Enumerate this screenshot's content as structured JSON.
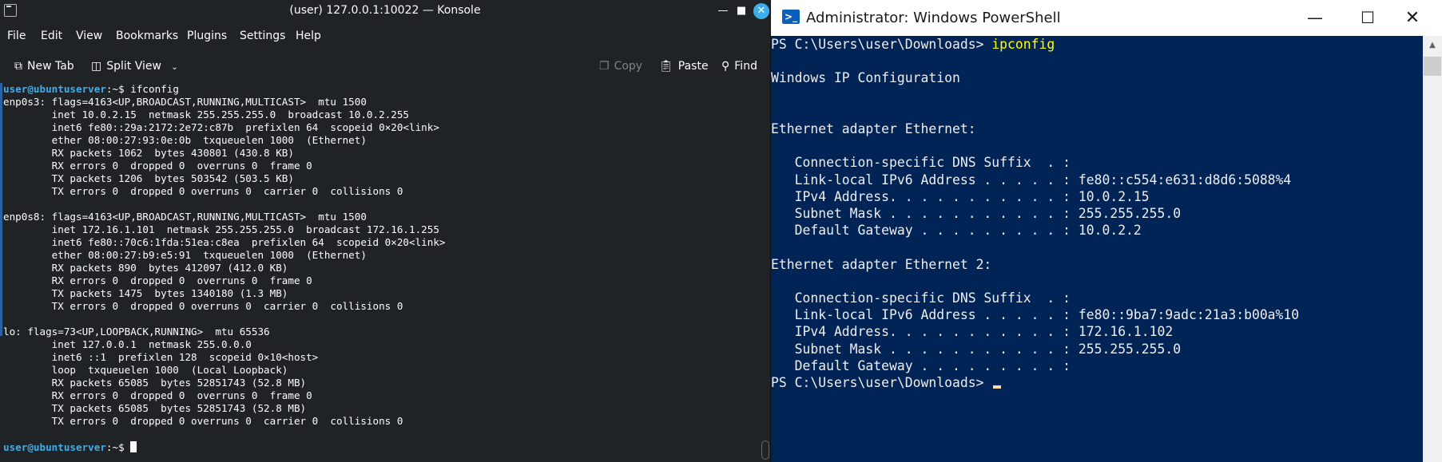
{
  "konsole": {
    "title": "(user) 127.0.0.1:10022 — Konsole",
    "menu": [
      "File",
      "Edit",
      "View",
      "Bookmarks",
      "Plugins",
      "Settings",
      "Help"
    ],
    "toolbar": {
      "new_tab": "New Tab",
      "split_view": "Split View",
      "copy": "Copy",
      "paste": "Paste",
      "find": "Find"
    },
    "prompt_user": "user@ubuntuserver",
    "prompt_suffix": ":~$ ",
    "command": "ifconfig",
    "output_lines": [
      "enp0s3: flags=4163<UP,BROADCAST,RUNNING,MULTICAST>  mtu 1500",
      "        inet 10.0.2.15  netmask 255.255.255.0  broadcast 10.0.2.255",
      "        inet6 fe80::29a:2172:2e72:c87b  prefixlen 64  scopeid 0×20<link>",
      "        ether 08:00:27:93:0e:0b  txqueuelen 1000  (Ethernet)",
      "        RX packets 1062  bytes 430801 (430.8 KB)",
      "        RX errors 0  dropped 0  overruns 0  frame 0",
      "        TX packets 1206  bytes 503542 (503.5 KB)",
      "        TX errors 0  dropped 0 overruns 0  carrier 0  collisions 0",
      "",
      "enp0s8: flags=4163<UP,BROADCAST,RUNNING,MULTICAST>  mtu 1500",
      "        inet 172.16.1.101  netmask 255.255.255.0  broadcast 172.16.1.255",
      "        inet6 fe80::70c6:1fda:51ea:c8ea  prefixlen 64  scopeid 0×20<link>",
      "        ether 08:00:27:b9:e5:91  txqueuelen 1000  (Ethernet)",
      "        RX packets 890  bytes 412097 (412.0 KB)",
      "        RX errors 0  dropped 0  overruns 0  frame 0",
      "        TX packets 1475  bytes 1340180 (1.3 MB)",
      "        TX errors 0  dropped 0 overruns 0  carrier 0  collisions 0",
      "",
      "lo: flags=73<UP,LOOPBACK,RUNNING>  mtu 65536",
      "        inet 127.0.0.1  netmask 255.0.0.0",
      "        inet6 ::1  prefixlen 128  scopeid 0×10<host>",
      "        loop  txqueuelen 1000  (Local Loopback)",
      "        RX packets 65085  bytes 52851743 (52.8 MB)",
      "        RX errors 0  dropped 0  overruns 0  frame 0",
      "        TX packets 65085  bytes 52851743 (52.8 MB)",
      "        TX errors 0  dropped 0 overruns 0  carrier 0  collisions 0"
    ]
  },
  "powershell": {
    "title": "Administrator: Windows PowerShell",
    "prompt": "PS C:\\Users\\user\\Downloads> ",
    "command": "ipconfig",
    "output_lines": [
      "",
      "Windows IP Configuration",
      "",
      "",
      "Ethernet adapter Ethernet:",
      "",
      "   Connection-specific DNS Suffix  . :",
      "   Link-local IPv6 Address . . . . . : fe80::c554:e631:d8d6:5088%4",
      "   IPv4 Address. . . . . . . . . . . : 10.0.2.15",
      "   Subnet Mask . . . . . . . . . . . : 255.255.255.0",
      "   Default Gateway . . . . . . . . . : 10.0.2.2",
      "",
      "Ethernet adapter Ethernet 2:",
      "",
      "   Connection-specific DNS Suffix  . :",
      "   Link-local IPv6 Address . . . . . : fe80::9ba7:9adc:21a3:b00a%10",
      "   IPv4 Address. . . . . . . . . . . : 172.16.1.102",
      "   Subnet Mask . . . . . . . . . . . : 255.255.255.0",
      "   Default Gateway . . . . . . . . . :"
    ],
    "final_prompt": "PS C:\\Users\\user\\Downloads> "
  },
  "colors": {
    "konsole_bg": "#202326",
    "konsole_prompt": "#3daee9",
    "ps_bg": "#012456",
    "ps_command": "#ffff00"
  }
}
